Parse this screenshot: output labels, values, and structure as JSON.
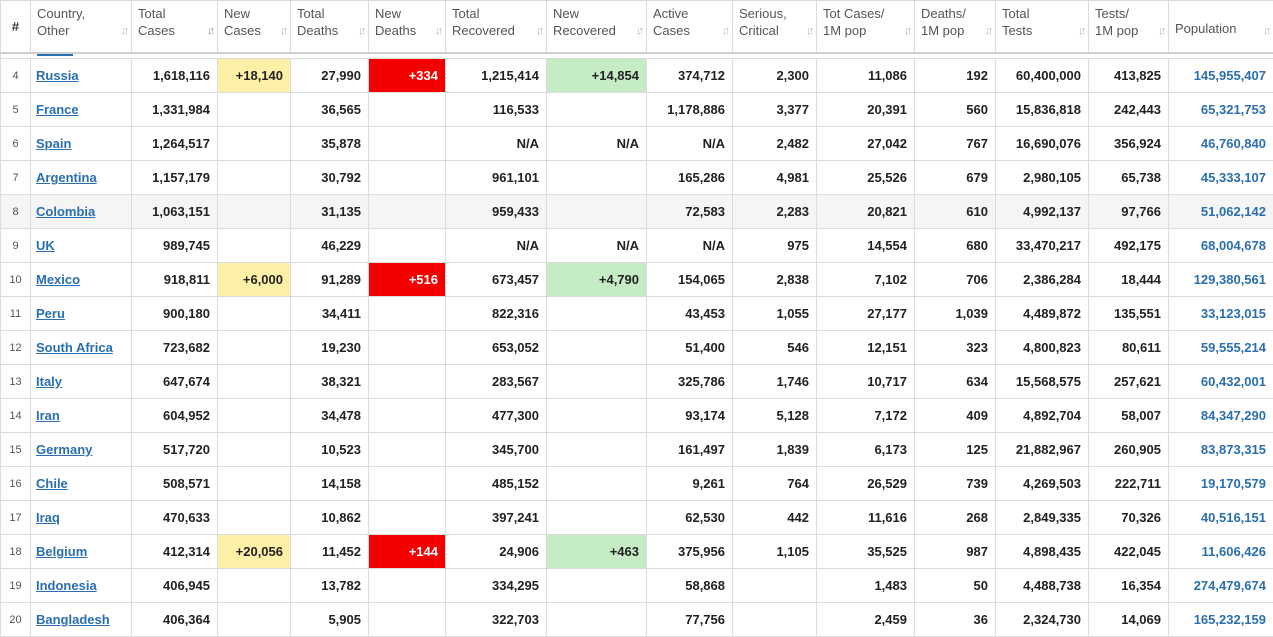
{
  "columns": [
    {
      "key": "rank",
      "label": "#"
    },
    {
      "key": "country",
      "label": "Country,\nOther"
    },
    {
      "key": "total_cases",
      "label": "Total\nCases"
    },
    {
      "key": "new_cases",
      "label": "New\nCases"
    },
    {
      "key": "total_deaths",
      "label": "Total\nDeaths"
    },
    {
      "key": "new_deaths",
      "label": "New\nDeaths"
    },
    {
      "key": "total_recovered",
      "label": "Total\nRecovered"
    },
    {
      "key": "new_recovered",
      "label": "New\nRecovered"
    },
    {
      "key": "active_cases",
      "label": "Active\nCases"
    },
    {
      "key": "serious_critical",
      "label": "Serious,\nCritical"
    },
    {
      "key": "tot_cases_1m",
      "label": "Tot Cases/\n1M pop"
    },
    {
      "key": "deaths_1m",
      "label": "Deaths/\n1M pop"
    },
    {
      "key": "total_tests",
      "label": "Total\nTests"
    },
    {
      "key": "tests_1m",
      "label": "Tests/\n1M pop"
    },
    {
      "key": "population",
      "label": "Population"
    }
  ],
  "colors": {
    "link": "#2a6fb0",
    "new_cases_bg": "#fff0a8",
    "new_deaths_bg": "#f40000",
    "new_recovered_bg": "#c6ecc6"
  },
  "rows": [
    {
      "rank": "4",
      "country": "Russia",
      "total_cases": "1,618,116",
      "new_cases": "+18,140",
      "total_deaths": "27,990",
      "new_deaths": "+334",
      "total_recovered": "1,215,414",
      "new_recovered": "+14,854",
      "active_cases": "374,712",
      "serious_critical": "2,300",
      "tot_cases_1m": "11,086",
      "deaths_1m": "192",
      "total_tests": "60,400,000",
      "tests_1m": "413,825",
      "population": "145,955,407"
    },
    {
      "rank": "5",
      "country": "France",
      "total_cases": "1,331,984",
      "new_cases": "",
      "total_deaths": "36,565",
      "new_deaths": "",
      "total_recovered": "116,533",
      "new_recovered": "",
      "active_cases": "1,178,886",
      "serious_critical": "3,377",
      "tot_cases_1m": "20,391",
      "deaths_1m": "560",
      "total_tests": "15,836,818",
      "tests_1m": "242,443",
      "population": "65,321,753"
    },
    {
      "rank": "6",
      "country": "Spain",
      "total_cases": "1,264,517",
      "new_cases": "",
      "total_deaths": "35,878",
      "new_deaths": "",
      "total_recovered": "N/A",
      "new_recovered": "N/A",
      "active_cases": "N/A",
      "serious_critical": "2,482",
      "tot_cases_1m": "27,042",
      "deaths_1m": "767",
      "total_tests": "16,690,076",
      "tests_1m": "356,924",
      "population": "46,760,840"
    },
    {
      "rank": "7",
      "country": "Argentina",
      "total_cases": "1,157,179",
      "new_cases": "",
      "total_deaths": "30,792",
      "new_deaths": "",
      "total_recovered": "961,101",
      "new_recovered": "",
      "active_cases": "165,286",
      "serious_critical": "4,981",
      "tot_cases_1m": "25,526",
      "deaths_1m": "679",
      "total_tests": "2,980,105",
      "tests_1m": "65,738",
      "population": "45,333,107"
    },
    {
      "rank": "8",
      "country": "Colombia",
      "total_cases": "1,063,151",
      "new_cases": "",
      "total_deaths": "31,135",
      "new_deaths": "",
      "total_recovered": "959,433",
      "new_recovered": "",
      "active_cases": "72,583",
      "serious_critical": "2,283",
      "tot_cases_1m": "20,821",
      "deaths_1m": "610",
      "total_tests": "4,992,137",
      "tests_1m": "97,766",
      "population": "51,062,142"
    },
    {
      "rank": "9",
      "country": "UK",
      "total_cases": "989,745",
      "new_cases": "",
      "total_deaths": "46,229",
      "new_deaths": "",
      "total_recovered": "N/A",
      "new_recovered": "N/A",
      "active_cases": "N/A",
      "serious_critical": "975",
      "tot_cases_1m": "14,554",
      "deaths_1m": "680",
      "total_tests": "33,470,217",
      "tests_1m": "492,175",
      "population": "68,004,678"
    },
    {
      "rank": "10",
      "country": "Mexico",
      "total_cases": "918,811",
      "new_cases": "+6,000",
      "total_deaths": "91,289",
      "new_deaths": "+516",
      "total_recovered": "673,457",
      "new_recovered": "+4,790",
      "active_cases": "154,065",
      "serious_critical": "2,838",
      "tot_cases_1m": "7,102",
      "deaths_1m": "706",
      "total_tests": "2,386,284",
      "tests_1m": "18,444",
      "population": "129,380,561"
    },
    {
      "rank": "11",
      "country": "Peru",
      "total_cases": "900,180",
      "new_cases": "",
      "total_deaths": "34,411",
      "new_deaths": "",
      "total_recovered": "822,316",
      "new_recovered": "",
      "active_cases": "43,453",
      "serious_critical": "1,055",
      "tot_cases_1m": "27,177",
      "deaths_1m": "1,039",
      "total_tests": "4,489,872",
      "tests_1m": "135,551",
      "population": "33,123,015"
    },
    {
      "rank": "12",
      "country": "South Africa",
      "total_cases": "723,682",
      "new_cases": "",
      "total_deaths": "19,230",
      "new_deaths": "",
      "total_recovered": "653,052",
      "new_recovered": "",
      "active_cases": "51,400",
      "serious_critical": "546",
      "tot_cases_1m": "12,151",
      "deaths_1m": "323",
      "total_tests": "4,800,823",
      "tests_1m": "80,611",
      "population": "59,555,214"
    },
    {
      "rank": "13",
      "country": "Italy",
      "total_cases": "647,674",
      "new_cases": "",
      "total_deaths": "38,321",
      "new_deaths": "",
      "total_recovered": "283,567",
      "new_recovered": "",
      "active_cases": "325,786",
      "serious_critical": "1,746",
      "tot_cases_1m": "10,717",
      "deaths_1m": "634",
      "total_tests": "15,568,575",
      "tests_1m": "257,621",
      "population": "60,432,001"
    },
    {
      "rank": "14",
      "country": "Iran",
      "total_cases": "604,952",
      "new_cases": "",
      "total_deaths": "34,478",
      "new_deaths": "",
      "total_recovered": "477,300",
      "new_recovered": "",
      "active_cases": "93,174",
      "serious_critical": "5,128",
      "tot_cases_1m": "7,172",
      "deaths_1m": "409",
      "total_tests": "4,892,704",
      "tests_1m": "58,007",
      "population": "84,347,290"
    },
    {
      "rank": "15",
      "country": "Germany",
      "total_cases": "517,720",
      "new_cases": "",
      "total_deaths": "10,523",
      "new_deaths": "",
      "total_recovered": "345,700",
      "new_recovered": "",
      "active_cases": "161,497",
      "serious_critical": "1,839",
      "tot_cases_1m": "6,173",
      "deaths_1m": "125",
      "total_tests": "21,882,967",
      "tests_1m": "260,905",
      "population": "83,873,315"
    },
    {
      "rank": "16",
      "country": "Chile",
      "total_cases": "508,571",
      "new_cases": "",
      "total_deaths": "14,158",
      "new_deaths": "",
      "total_recovered": "485,152",
      "new_recovered": "",
      "active_cases": "9,261",
      "serious_critical": "764",
      "tot_cases_1m": "26,529",
      "deaths_1m": "739",
      "total_tests": "4,269,503",
      "tests_1m": "222,711",
      "population": "19,170,579"
    },
    {
      "rank": "17",
      "country": "Iraq",
      "total_cases": "470,633",
      "new_cases": "",
      "total_deaths": "10,862",
      "new_deaths": "",
      "total_recovered": "397,241",
      "new_recovered": "",
      "active_cases": "62,530",
      "serious_critical": "442",
      "tot_cases_1m": "11,616",
      "deaths_1m": "268",
      "total_tests": "2,849,335",
      "tests_1m": "70,326",
      "population": "40,516,151"
    },
    {
      "rank": "18",
      "country": "Belgium",
      "total_cases": "412,314",
      "new_cases": "+20,056",
      "total_deaths": "11,452",
      "new_deaths": "+144",
      "total_recovered": "24,906",
      "new_recovered": "+463",
      "active_cases": "375,956",
      "serious_critical": "1,105",
      "tot_cases_1m": "35,525",
      "deaths_1m": "987",
      "total_tests": "4,898,435",
      "tests_1m": "422,045",
      "population": "11,606,426"
    },
    {
      "rank": "19",
      "country": "Indonesia",
      "total_cases": "406,945",
      "new_cases": "",
      "total_deaths": "13,782",
      "new_deaths": "",
      "total_recovered": "334,295",
      "new_recovered": "",
      "active_cases": "58,868",
      "serious_critical": "",
      "tot_cases_1m": "1,483",
      "deaths_1m": "50",
      "total_tests": "4,488,738",
      "tests_1m": "16,354",
      "population": "274,479,674"
    },
    {
      "rank": "20",
      "country": "Bangladesh",
      "total_cases": "406,364",
      "new_cases": "",
      "total_deaths": "5,905",
      "new_deaths": "",
      "total_recovered": "322,703",
      "new_recovered": "",
      "active_cases": "77,756",
      "serious_critical": "",
      "tot_cases_1m": "2,459",
      "deaths_1m": "36",
      "total_tests": "2,324,730",
      "tests_1m": "14,069",
      "population": "165,232,159"
    }
  ]
}
